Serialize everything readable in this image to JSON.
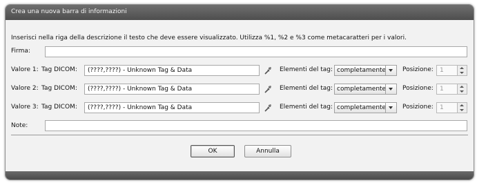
{
  "dialog": {
    "title": "Crea una nuova barra di informazioni",
    "description": "Inserisci nella riga della descrizione  il testo che deve essere visualizzato. Utilizza %1, %2 e %3 come metacaratteri per i valori.",
    "firma_label": "Firma:",
    "firma_value": "",
    "note_label": "Note:",
    "note_value": "",
    "rows": [
      {
        "valore_label": "Valore 1:",
        "tag_label": "Tag DICOM:",
        "tag_value": "(????,????) - Unknown Tag & Data",
        "picker_icon": "dropper-icon",
        "elementi_label": "Elementi del tag:",
        "elementi_value": "completamente",
        "posizione_label": "Posizione:",
        "posizione_value": "1"
      },
      {
        "valore_label": "Valore 2:",
        "tag_label": "Tag DICOM:",
        "tag_value": "(????,????) - Unknown Tag & Data",
        "picker_icon": "dropper-icon",
        "elementi_label": "Elementi del tag:",
        "elementi_value": "completamente",
        "posizione_label": "Posizione:",
        "posizione_value": "1"
      },
      {
        "valore_label": "Valore 3:",
        "tag_label": "Tag DICOM:",
        "tag_value": "(????,????) - Unknown Tag & Data",
        "picker_icon": "dropper-icon",
        "elementi_label": "Elementi del tag:",
        "elementi_value": "completamente",
        "posizione_label": "Posizione:",
        "posizione_value": "1"
      }
    ],
    "ok_label": "OK",
    "cancel_label": "Annulla"
  }
}
